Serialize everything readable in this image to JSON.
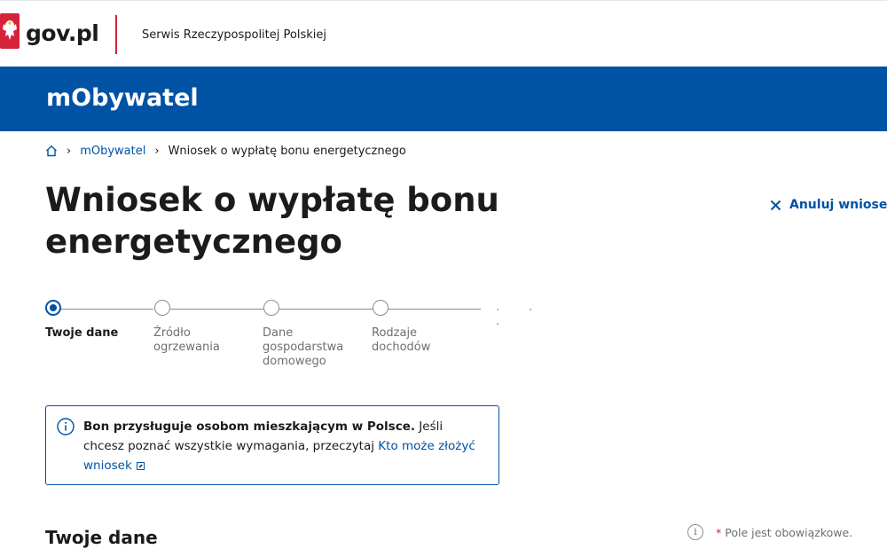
{
  "header": {
    "brand": "gov.pl",
    "service": "Serwis Rzeczypospolitej Polskiej",
    "accent_color": "#d5233b"
  },
  "banner": {
    "title": "mObywatel",
    "color": "#0052a5"
  },
  "breadcrumb": {
    "home_icon": "home-icon",
    "items": [
      "mObywatel",
      "Wniosek o wypłatę bonu energetycznego"
    ]
  },
  "page": {
    "title": "Wniosek o wypłatę bonu energetycznego"
  },
  "actions": {
    "cancel_label": "Anuluj wniosek"
  },
  "stepper": {
    "steps": [
      {
        "label": "Twoje dane",
        "active": true
      },
      {
        "label": "Źródło ogrzewania",
        "active": false
      },
      {
        "label": "Dane gospodarstwa domowego",
        "active": false
      },
      {
        "label": "Rodzaje dochodów",
        "active": false
      }
    ],
    "more": "· · ·"
  },
  "info": {
    "bold": "Bon przysługuje osobom mieszkającym w Polsce.",
    "text": " Jeśli chcesz poznać wszystkie wymagania, przeczytaj ",
    "link": "Kto może złożyć wniosek"
  },
  "section": {
    "title": "Twoje dane",
    "required_star": "*",
    "required_note": "Pole jest obowiązkowe."
  }
}
